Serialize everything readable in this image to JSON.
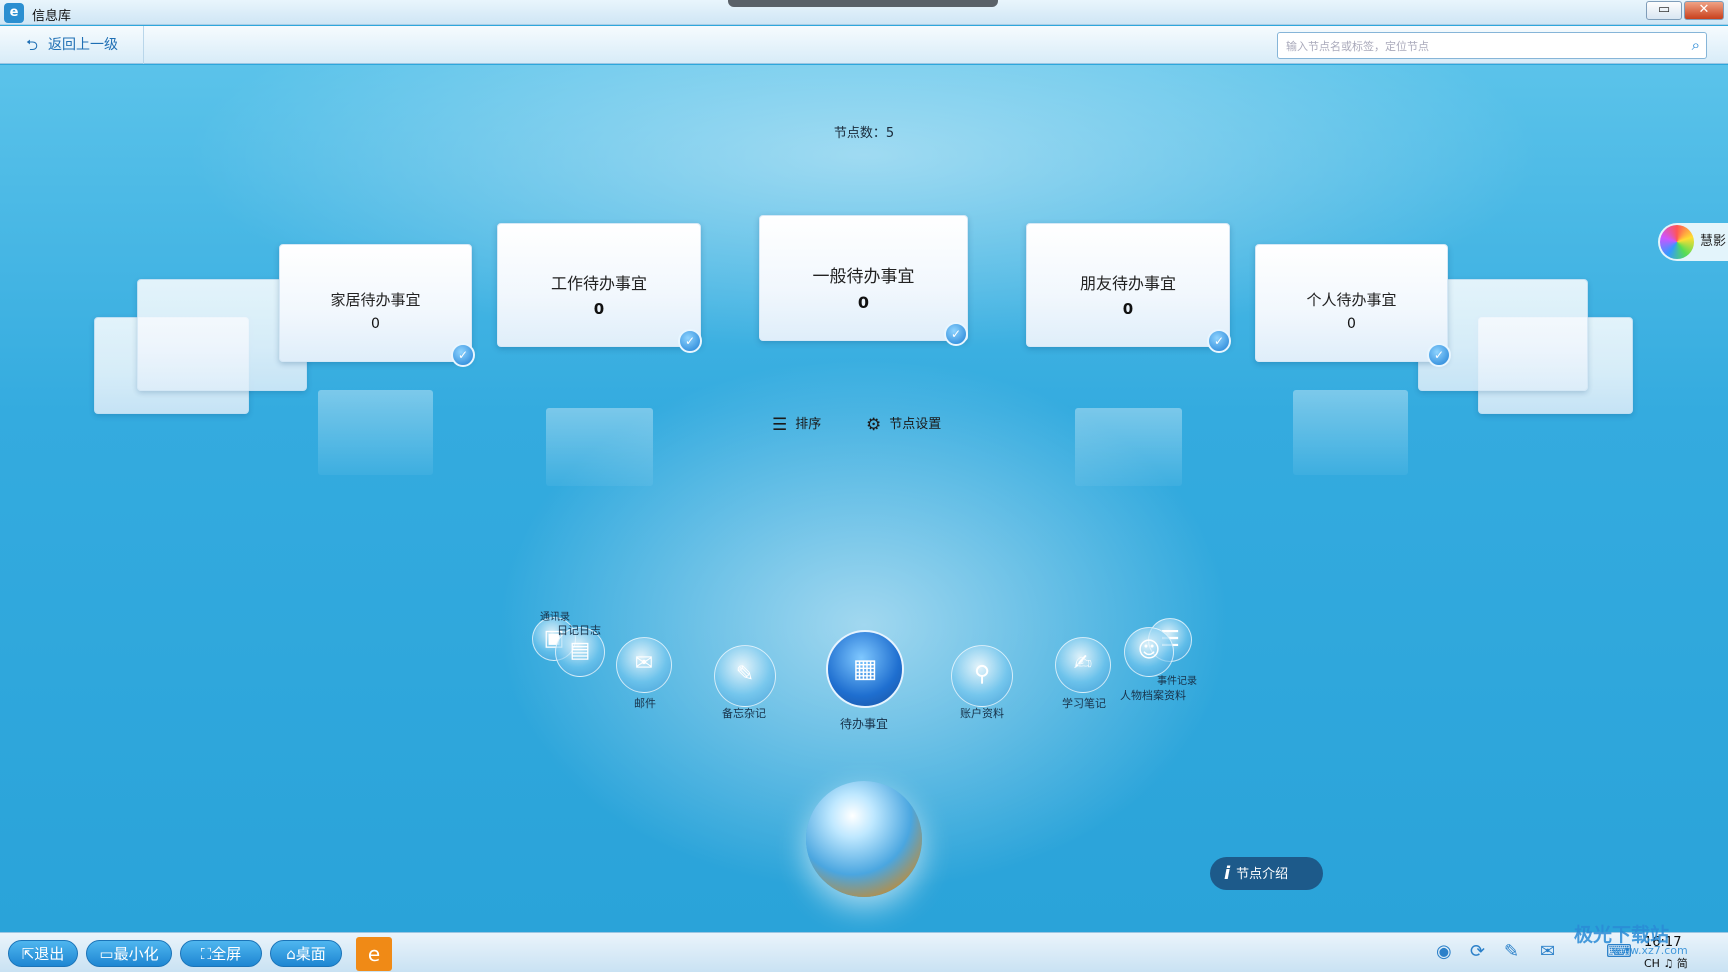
{
  "window": {
    "title": "信息库",
    "minimize_glyph": "▭",
    "close_glyph": "✕"
  },
  "toolbar": {
    "back_label": "返回上一级",
    "search_placeholder": "输入节点名或标签，定位节点"
  },
  "main": {
    "node_count_label": "节点数：5",
    "cards": [
      {
        "name": "家居待办事宜",
        "count": "0"
      },
      {
        "name": "工作待办事宜",
        "count": "0"
      },
      {
        "name": "一般待办事宜",
        "count": "0"
      },
      {
        "name": "朋友待办事宜",
        "count": "0"
      },
      {
        "name": "个人待办事宜",
        "count": "0"
      }
    ],
    "controls": {
      "sort_label": "排序",
      "settings_label": "节点设置"
    },
    "bubbles": [
      {
        "label": "通讯录"
      },
      {
        "label": "日记日志"
      },
      {
        "label": "邮件"
      },
      {
        "label": "备忘杂记"
      },
      {
        "label": "待办事宜"
      },
      {
        "label": "账户资料"
      },
      {
        "label": "学习笔记"
      },
      {
        "label": "事件记录"
      },
      {
        "label": "人物档案资料"
      }
    ],
    "info_button_label": "节点介绍",
    "side_orb_label": "慧影"
  },
  "taskbar": {
    "exit_label": "退出",
    "minimize_label": "最小化",
    "fullscreen_label": "全屏",
    "desktop_label": "桌面",
    "time": "16:17",
    "lang": "CH ♫ 简",
    "watermark": "极光下载站",
    "watermark_url": "www.xz7.com"
  },
  "icons": {
    "app": "app-logo-icon",
    "back": "back-arrow-icon",
    "search": "search-icon",
    "sort": "list-icon",
    "settings": "gear-icon",
    "info": "info-icon"
  },
  "colors": {
    "background": "#2ea7dc",
    "accent": "#1e86d2",
    "taskbar_app": "#f08a16"
  }
}
